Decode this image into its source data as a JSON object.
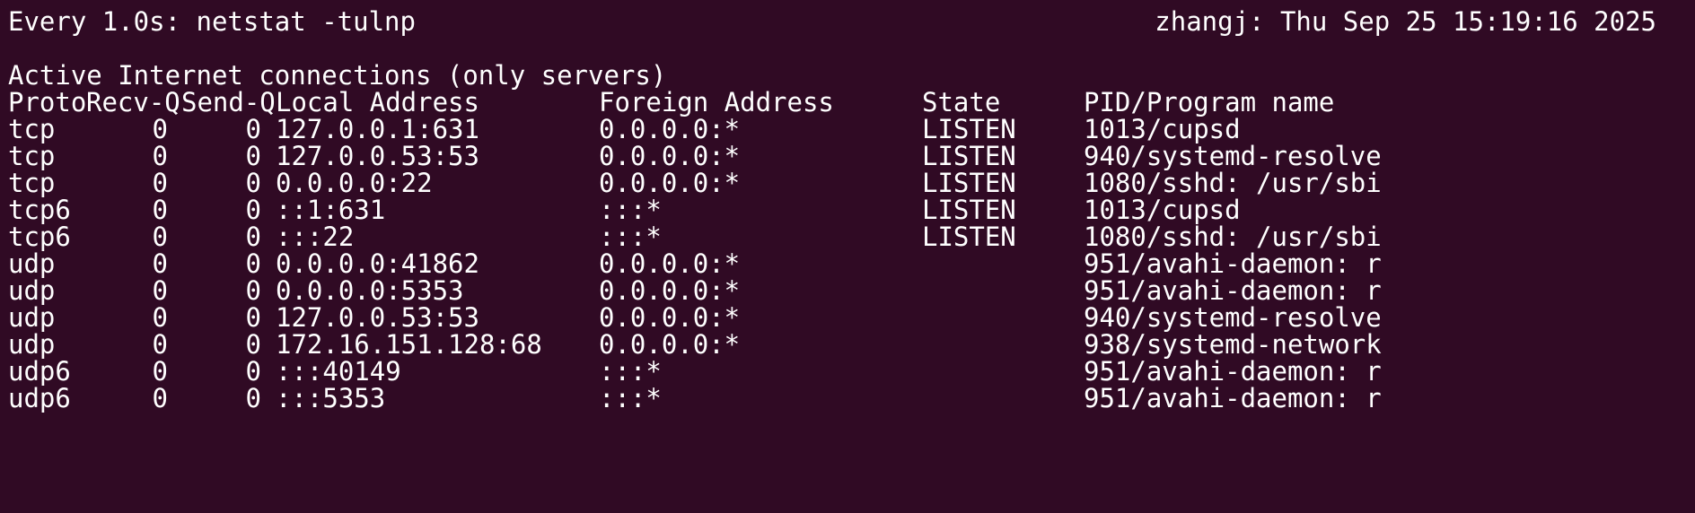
{
  "watch": {
    "header_left": "Every 1.0s: netstat -tulnp",
    "header_right": "zhangj: Thu Sep 25 15:19:16 2025"
  },
  "netstat": {
    "title": "Active Internet connections (only servers)",
    "columns": {
      "proto": "Proto",
      "recvq": "Recv-Q",
      "sendq": "Send-Q",
      "local": "Local Address",
      "foreign": "Foreign Address",
      "state": "State",
      "program": "PID/Program name"
    },
    "rows": [
      {
        "proto": "tcp",
        "recvq": "0",
        "sendq": "0",
        "local": "127.0.0.1:631",
        "foreign": "0.0.0.0:*",
        "state": "LISTEN",
        "program": "1013/cupsd"
      },
      {
        "proto": "tcp",
        "recvq": "0",
        "sendq": "0",
        "local": "127.0.0.53:53",
        "foreign": "0.0.0.0:*",
        "state": "LISTEN",
        "program": "940/systemd-resolve"
      },
      {
        "proto": "tcp",
        "recvq": "0",
        "sendq": "0",
        "local": "0.0.0.0:22",
        "foreign": "0.0.0.0:*",
        "state": "LISTEN",
        "program": "1080/sshd: /usr/sbi"
      },
      {
        "proto": "tcp6",
        "recvq": "0",
        "sendq": "0",
        "local": "::1:631",
        "foreign": ":::*",
        "state": "LISTEN",
        "program": "1013/cupsd"
      },
      {
        "proto": "tcp6",
        "recvq": "0",
        "sendq": "0",
        "local": ":::22",
        "foreign": ":::*",
        "state": "LISTEN",
        "program": "1080/sshd: /usr/sbi"
      },
      {
        "proto": "udp",
        "recvq": "0",
        "sendq": "0",
        "local": "0.0.0.0:41862",
        "foreign": "0.0.0.0:*",
        "state": "",
        "program": "951/avahi-daemon: r"
      },
      {
        "proto": "udp",
        "recvq": "0",
        "sendq": "0",
        "local": "0.0.0.0:5353",
        "foreign": "0.0.0.0:*",
        "state": "",
        "program": "951/avahi-daemon: r"
      },
      {
        "proto": "udp",
        "recvq": "0",
        "sendq": "0",
        "local": "127.0.0.53:53",
        "foreign": "0.0.0.0:*",
        "state": "",
        "program": "940/systemd-resolve"
      },
      {
        "proto": "udp",
        "recvq": "0",
        "sendq": "0",
        "local": "172.16.151.128:68",
        "foreign": "0.0.0.0:*",
        "state": "",
        "program": "938/systemd-network"
      },
      {
        "proto": "udp6",
        "recvq": "0",
        "sendq": "0",
        "local": ":::40149",
        "foreign": ":::*",
        "state": "",
        "program": "951/avahi-daemon: r"
      },
      {
        "proto": "udp6",
        "recvq": "0",
        "sendq": "0",
        "local": ":::5353",
        "foreign": ":::*",
        "state": "",
        "program": "951/avahi-daemon: r"
      }
    ]
  },
  "colors": {
    "background": "#300a24",
    "foreground": "#ffffff"
  }
}
